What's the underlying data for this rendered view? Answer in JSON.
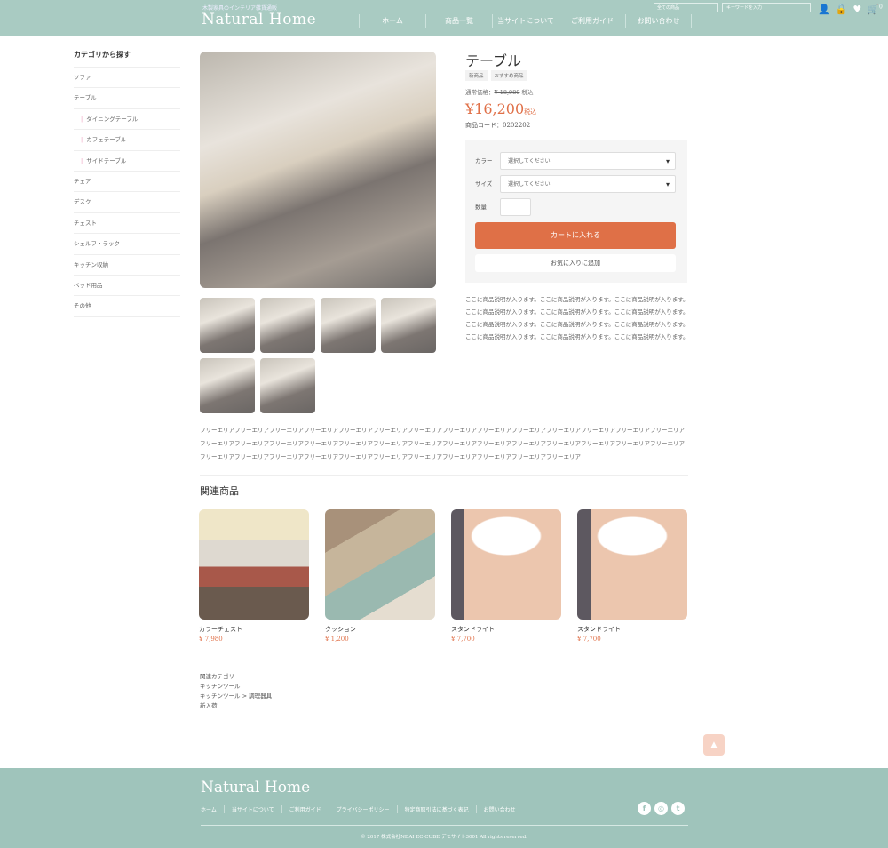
{
  "header": {
    "tagline": "木製家具のインテリア雑貨通販",
    "logo": "Natural Home",
    "nav": [
      "ホーム",
      "商品一覧",
      "当サイトについて",
      "ご利用ガイド",
      "お問い合わせ"
    ],
    "search_select": "全ての商品",
    "search_placeholder": "キーワードを入力",
    "cart_count": "0",
    "icons": [
      "user-icon",
      "lock-icon",
      "heart-icon",
      "cart-icon"
    ]
  },
  "sidebar": {
    "title": "カテゴリから探す",
    "items": [
      {
        "label": "ソファ",
        "sub": false
      },
      {
        "label": "テーブル",
        "sub": false
      },
      {
        "label": "ダイニングテーブル",
        "sub": true
      },
      {
        "label": "カフェテーブル",
        "sub": true
      },
      {
        "label": "サイドテーブル",
        "sub": true
      },
      {
        "label": "チェア",
        "sub": false
      },
      {
        "label": "デスク",
        "sub": false
      },
      {
        "label": "チェスト",
        "sub": false
      },
      {
        "label": "シェルフ・ラック",
        "sub": false
      },
      {
        "label": "キッチン収納",
        "sub": false
      },
      {
        "label": "ベッド用品",
        "sub": false
      },
      {
        "label": "その他",
        "sub": false
      }
    ]
  },
  "product": {
    "title": "テーブル",
    "badges": [
      "新商品",
      "おすすめ商品"
    ],
    "regular_label": "通常価格：",
    "regular_price": "¥ 18,980",
    "tax": "税込",
    "price": "¥16,200",
    "code_label": "商品コード：",
    "code": "0202202",
    "color_label": "カラー",
    "color_value": "選択してください",
    "size_label": "サイズ",
    "size_value": "選択してください",
    "qty_label": "数量",
    "qty_value": "",
    "cart_button": "カートに入れる",
    "fav_button": "お気に入りに追加",
    "description": "ここに商品説明が入ります。ここに商品説明が入ります。ここに商品説明が入ります。ここに商品説明が入ります。ここに商品説明が入ります。ここに商品説明が入ります。ここに商品説明が入ります。ここに商品説明が入ります。ここに商品説明が入ります。ここに商品説明が入ります。ここに商品説明が入ります。ここに商品説明が入ります。"
  },
  "free_area": "フリーエリアフリーエリアフリーエリアフリーエリアフリーエリアフリーエリアフリーエリアフリーエリアフリーエリアフリーエリアフリーエリアフリーエリアフリーエリアフリーエリアフリーエリアフリーエリアフリーエリアフリーエリアフリーエリアフリーエリアフリーエリアフリーエリアフリーエリアフリーエリアフリーエリアフリーエリアフリーエリアフリーエリアフリーエリアフリーエリアフリーエリアフリーエリアフリーエリアフリーエリアフリーエリアフリーエリアフリーエリアフリーエリアフリーエリア",
  "related": {
    "title": "関連商品",
    "items": [
      {
        "name": "カラーチェスト",
        "price": "¥ 7,980"
      },
      {
        "name": "クッション",
        "price": "¥ 1,200"
      },
      {
        "name": "スタンドライト",
        "price": "¥ 7,700"
      },
      {
        "name": "スタンドライト",
        "price": "¥ 7,700"
      }
    ]
  },
  "categories": [
    "関連カテゴリ",
    "キッチンツール",
    "キッチンツール > 調理器具",
    "新入荷"
  ],
  "footer": {
    "logo": "Natural Home",
    "nav": [
      "ホーム",
      "当サイトについて",
      "ご利用ガイド",
      "プライバシーポリシー",
      "特定商取引法に基づく表記",
      "お問い合わせ"
    ],
    "sns": [
      "facebook-icon",
      "instagram-icon",
      "twitter-icon"
    ],
    "copyright": "© 2017 株式会社NDAI EC-CUBE デモサイト3001 All rights reserved."
  },
  "colors": {
    "header": "#a9cbc2",
    "footer": "#9fc4bb",
    "accent": "#df7047"
  }
}
